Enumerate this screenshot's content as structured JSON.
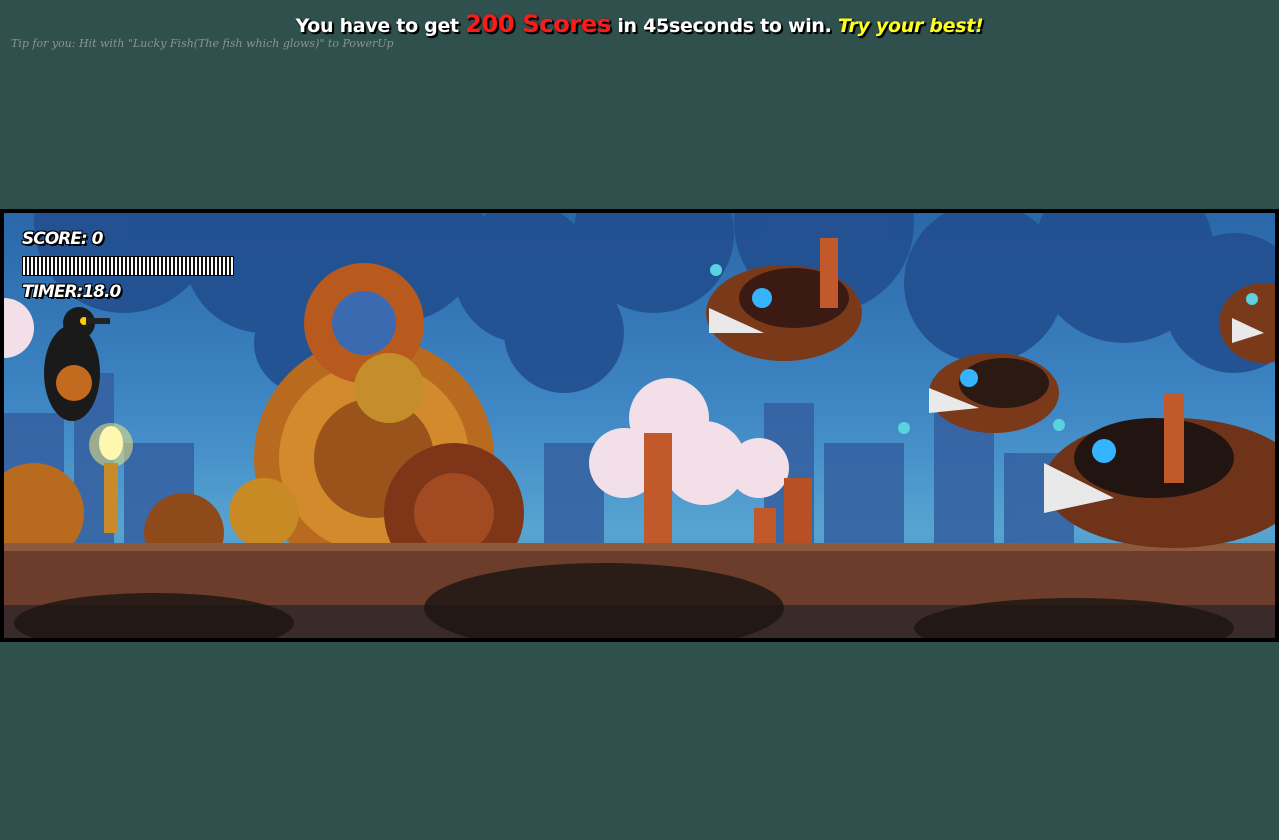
{
  "header": {
    "intro": "You have to get",
    "goal": "200 Scores",
    "rest": "in 45seconds to win.",
    "cheer": "Try your best!"
  },
  "tip": "Tip for you: Hit with \"Lucky Fish(The fish which glows)\" to PowerUp",
  "hud": {
    "score_label": "SCORE: 0",
    "timer_label": "TIMER:18.0"
  }
}
